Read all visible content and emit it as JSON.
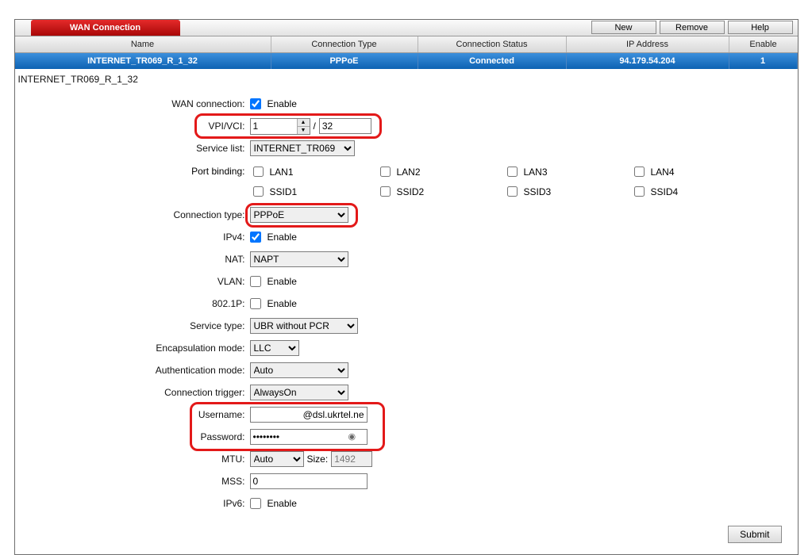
{
  "header": {
    "title": "WAN Connection",
    "buttons": {
      "new": "New",
      "remove": "Remove",
      "help": "Help"
    }
  },
  "grid": {
    "cols": {
      "name": "Name",
      "type": "Connection Type",
      "status": "Connection Status",
      "ip": "IP Address",
      "enable": "Enable"
    },
    "row": {
      "name": "INTERNET_TR069_R_1_32",
      "type": "PPPoE",
      "status": "Connected",
      "ip": "94.179.54.204",
      "enable": "1"
    }
  },
  "form": {
    "section_name": "INTERNET_TR069_R_1_32",
    "labels": {
      "wan_connection": "WAN connection:",
      "vpi_vci": "VPI/VCI:",
      "service_list": "Service list:",
      "port_binding": "Port binding:",
      "connection_type": "Connection type:",
      "ipv4": "IPv4:",
      "nat": "NAT:",
      "vlan": "VLAN:",
      "p8021": "802.1P:",
      "service_type": "Service type:",
      "encapsulation_mode": "Encapsulation mode:",
      "authentication_mode": "Authentication mode:",
      "connection_trigger": "Connection trigger:",
      "username": "Username:",
      "password": "Password:",
      "mtu": "MTU:",
      "size": "Size:",
      "mss": "MSS:",
      "ipv6": "IPv6:",
      "enable": "Enable",
      "vci_sep": "/"
    },
    "values": {
      "wan_connection_checked": true,
      "vpi": "1",
      "vci": "32",
      "service_list": "INTERNET_TR069",
      "port_binding": {
        "LAN1": false,
        "LAN2": false,
        "LAN3": false,
        "LAN4": false,
        "SSID1": false,
        "SSID2": false,
        "SSID3": false,
        "SSID4": false
      },
      "port_binding_labels": {
        "LAN1": "LAN1",
        "LAN2": "LAN2",
        "LAN3": "LAN3",
        "LAN4": "LAN4",
        "SSID1": "SSID1",
        "SSID2": "SSID2",
        "SSID3": "SSID3",
        "SSID4": "SSID4"
      },
      "connection_type": "PPPoE",
      "ipv4_checked": true,
      "nat": "NAPT",
      "vlan_checked": false,
      "p8021_checked": false,
      "service_type": "UBR without PCR",
      "encapsulation_mode": "LLC",
      "authentication_mode": "Auto",
      "connection_trigger": "AlwaysOn",
      "username": "@dsl.ukrtel.ne",
      "password": "••••••••",
      "mtu": "Auto",
      "mtu_size": "1492",
      "mss": "0",
      "ipv6_checked": false
    },
    "submit": "Submit"
  }
}
